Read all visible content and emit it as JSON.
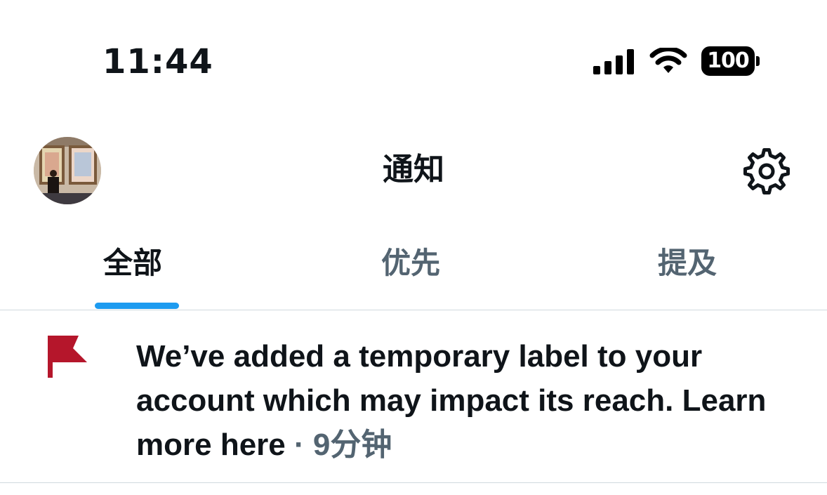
{
  "status_bar": {
    "time": "11:44",
    "battery": "100",
    "icons": [
      "cellular-signal-icon",
      "wifi-icon",
      "battery-icon"
    ]
  },
  "header": {
    "title": "通知",
    "avatar_icon": "avatar",
    "settings_icon": "gear-icon"
  },
  "tabs": [
    {
      "label": "全部",
      "active": true
    },
    {
      "label": "优先",
      "active": false
    },
    {
      "label": "提及",
      "active": false
    }
  ],
  "notification": {
    "icon": "flag-icon",
    "icon_color": "#b5162b",
    "message": "We’ve added a temporary label to your account which may impact its reach.",
    "link": "Learn more here",
    "separator": "·",
    "time_ago": "9分钟"
  },
  "colors": {
    "accent": "#1d9bf0",
    "text": "#0f1419",
    "secondary": "#536471"
  }
}
